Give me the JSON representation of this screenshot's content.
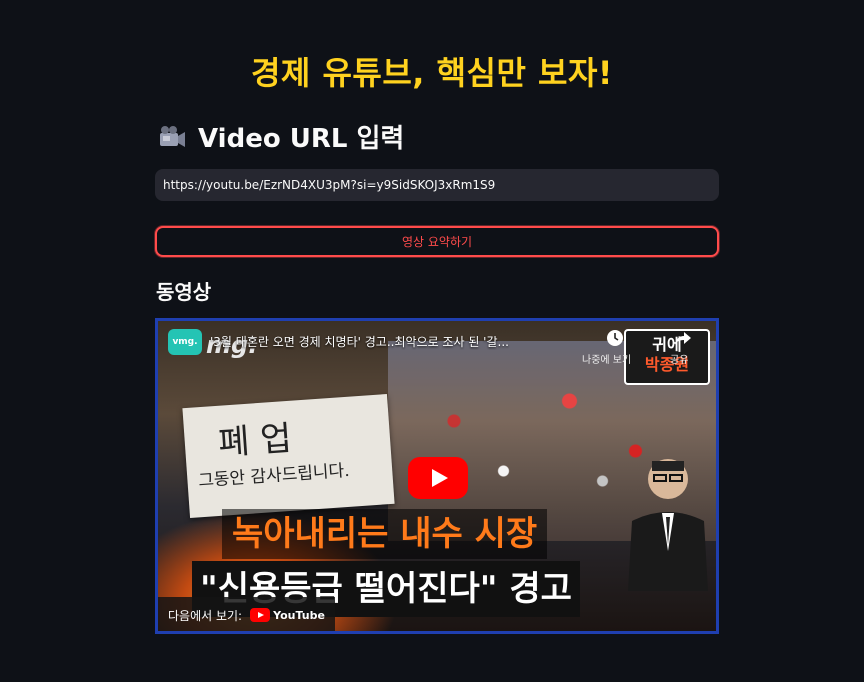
{
  "page": {
    "title": "경제 유튜브, 핵심만 보자!",
    "section_title": "Video URL 입력",
    "url_value": "https://youtu.be/EzrND4XU3pM?si=y9SidSKOJ3xRm1S9",
    "summarize_button": "영상 요약하기",
    "video_heading": "동영상"
  },
  "video": {
    "title": "'3월 대혼란 오면 경제 치명타' 경고..최악으로 조사 된 '갈...",
    "watch_later": "나중에 보기",
    "share": "공유",
    "channel_line1": "귀에",
    "channel_line2": "박종원",
    "badge": "vmg.",
    "brand": "mg.",
    "sign_big": "폐 업",
    "sign_small": "그동안 감사드립니다.",
    "caption_top": "녹아내리는 내수 시장",
    "caption_bottom": "\"신용등급 떨어진다\" 경고",
    "watch_on": "다음에서 보기:",
    "youtube": "YouTube"
  },
  "colors": {
    "background": "#0e1117",
    "title": "#ffd21f",
    "accent": "#ff4b4b",
    "input_bg": "#262730"
  },
  "icons": [
    "video-camera-icon",
    "play-icon",
    "clock-icon",
    "share-icon",
    "youtube-logo-icon"
  ]
}
